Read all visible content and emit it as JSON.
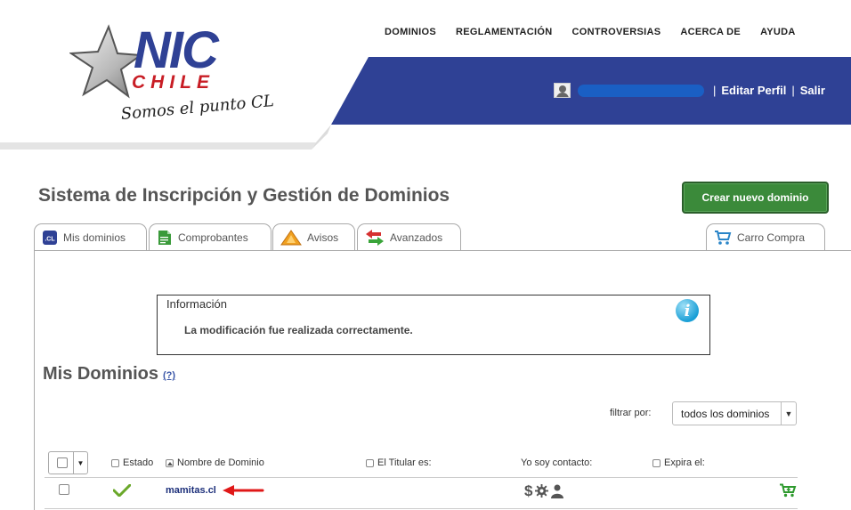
{
  "brand": {
    "logo_main": "NIC",
    "logo_sub": "CHILE",
    "tagline": "Somos el punto CL",
    "colors": {
      "blue": "#2f4195",
      "red": "#c81d25",
      "green": "#3b8a3a"
    }
  },
  "topnav": {
    "items": [
      {
        "label": "DOMINIOS"
      },
      {
        "label": "REGLAMENTACIÓN"
      },
      {
        "label": "CONTROVERSIAS"
      },
      {
        "label": "ACERCA DE"
      },
      {
        "label": "AYUDA"
      }
    ]
  },
  "user_bar": {
    "avatar_icon": "user-silhouette-icon",
    "username_redacted": true,
    "separator": "|",
    "edit_profile": "Editar Perfil",
    "logout": "Salir"
  },
  "page": {
    "title": "Sistema de Inscripción y Gestión de Dominios",
    "create_button": "Crear nuevo dominio"
  },
  "tabs": [
    {
      "label": "Mis dominios",
      "icon": "cl-domain-icon"
    },
    {
      "label": "Comprobantes",
      "icon": "document-icon"
    },
    {
      "label": "Avisos",
      "icon": "warning-icon"
    },
    {
      "label": "Avanzados",
      "icon": "transfer-arrows-icon"
    },
    {
      "label": "Carro Compra",
      "icon": "shopping-cart-icon"
    }
  ],
  "info": {
    "title": "Información",
    "message": "La modificación fue realizada correctamente.",
    "icon": "info-icon"
  },
  "section": {
    "title": "Mis Dominios",
    "help": "(?)"
  },
  "filter": {
    "label": "filtrar por:",
    "selected": "todos los dominios"
  },
  "table": {
    "columns": {
      "estado": "Estado",
      "nombre": "Nombre de Dominio",
      "titular": "El Titular es:",
      "contacto": "Yo soy contacto:",
      "expira": "Expira el:"
    },
    "rows": [
      {
        "status_icon": "checkmark-icon",
        "domain": "mamitas.cl",
        "contact_icons": [
          "dollar-icon",
          "gear-icon",
          "person-icon"
        ],
        "dollar": "$",
        "action_icon": "add-to-cart-icon"
      }
    ]
  }
}
